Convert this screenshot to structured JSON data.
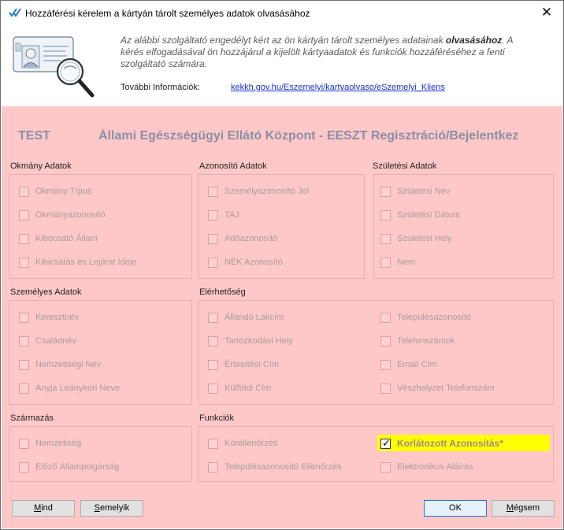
{
  "window": {
    "title": "Hozzáférési kérelem a kártyán tárolt személyes adatok olvasásához",
    "close_glyph": "✕"
  },
  "header": {
    "intro_part1": "Az alábbi szolgáltató engedélyt kért az ön kártyán tárolt személyes adatainak ",
    "intro_bold": "olvasásához",
    "intro_part2": ". A kérés elfogadásával ön hozzájárul a kijelölt kártyaadatok és funkciók hozzáféréséhez a fenti szolgáltató számára.",
    "more_info_label": "További Információk:",
    "more_info_link": "kekkh.gov.hu/Eszemelyi/kartyaolvaso/eSzemelyi_Kliens"
  },
  "organization": {
    "code": "TEST",
    "name": "Állami Egészségügyi Ellátó Központ - EESZT Regisztráció/Bejelentkez"
  },
  "groups": {
    "okmany": {
      "label": "Okmány Adatok",
      "items": [
        "Okmány Típus",
        "Okmányazonosító",
        "Kibocsátó Állam",
        "Kibicsátás és Lejárat Ideje"
      ]
    },
    "azonosito": {
      "label": "Azonosító Adatok",
      "items": [
        "Személyazonosító Jel",
        "TAJ",
        "Adóazonosító",
        "NEK Azonosító"
      ]
    },
    "szuletesi": {
      "label": "Születési Adatok",
      "items": [
        "Születési Név",
        "Születési Dátum",
        "Születési Hely",
        "Nem"
      ]
    },
    "szemelyes": {
      "label": "Személyes Adatok",
      "items": [
        "Keresztnév",
        "Családnév",
        "Nemzetiségi Név",
        "Anyja Leánykori Neve"
      ]
    },
    "elerhetoseg": {
      "label": "Elérhetőség",
      "col1": [
        "Állandó Lakcím",
        "Tartózkodási Hely",
        "Értesítési Cím",
        "Külföldi Cím"
      ],
      "col2": [
        "Településazonosító",
        "Telefonszámok",
        "Email Cím",
        "Vészhelyzet Telefonszám"
      ]
    },
    "szarmazas": {
      "label": "Származás",
      "items": [
        "Nemzetiség",
        "Előző Állampolgárság"
      ]
    },
    "funkciok": {
      "label": "Funkciók",
      "col1": [
        "Korellenőrzés",
        "Településazonosító Ellenőrzés"
      ],
      "col2": [
        "Korlátozott Azonosítás*",
        "Elektronikus Aláírás"
      ],
      "checked": "Korlátozott Azonosítás*"
    }
  },
  "buttons": {
    "all_first": "M",
    "all_rest": "ind",
    "none_first": "S",
    "none_rest": "emelyik",
    "ok": "OK",
    "cancel_first": "M",
    "cancel_rest": "égsem"
  },
  "colors": {
    "main_background": "#ffc8c8",
    "highlight": "#ffff00",
    "org_text": "#8a8ea8",
    "link": "#1a2fd8"
  }
}
